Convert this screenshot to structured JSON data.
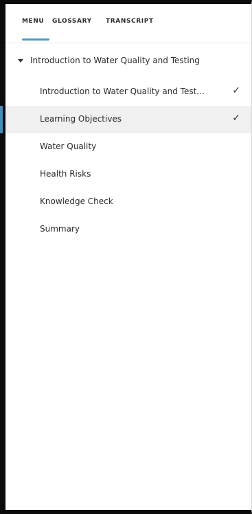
{
  "tabs": [
    {
      "label": "MENU"
    },
    {
      "label": "GLOSSARY"
    },
    {
      "label": "TRANSCRIPT"
    }
  ],
  "section": {
    "title": "Introduction to Water Quality and Testing",
    "expanded": true
  },
  "items": [
    {
      "label": "Introduction to Water Quality and Test...",
      "completed": true,
      "active": false
    },
    {
      "label": "Learning Objectives",
      "completed": true,
      "active": true
    },
    {
      "label": "Water Quality",
      "completed": false,
      "active": false
    },
    {
      "label": "Health Risks",
      "completed": false,
      "active": false
    },
    {
      "label": "Knowledge Check",
      "completed": false,
      "active": false
    },
    {
      "label": "Summary",
      "completed": false,
      "active": false
    }
  ],
  "icons": {
    "check": "✓",
    "caret": "caret-down-icon"
  },
  "colors": {
    "accent": "#4b9bc6",
    "active_bar": "#3f8fc0",
    "active_bg": "#f0f0f0",
    "text": "#2a2a2a"
  }
}
